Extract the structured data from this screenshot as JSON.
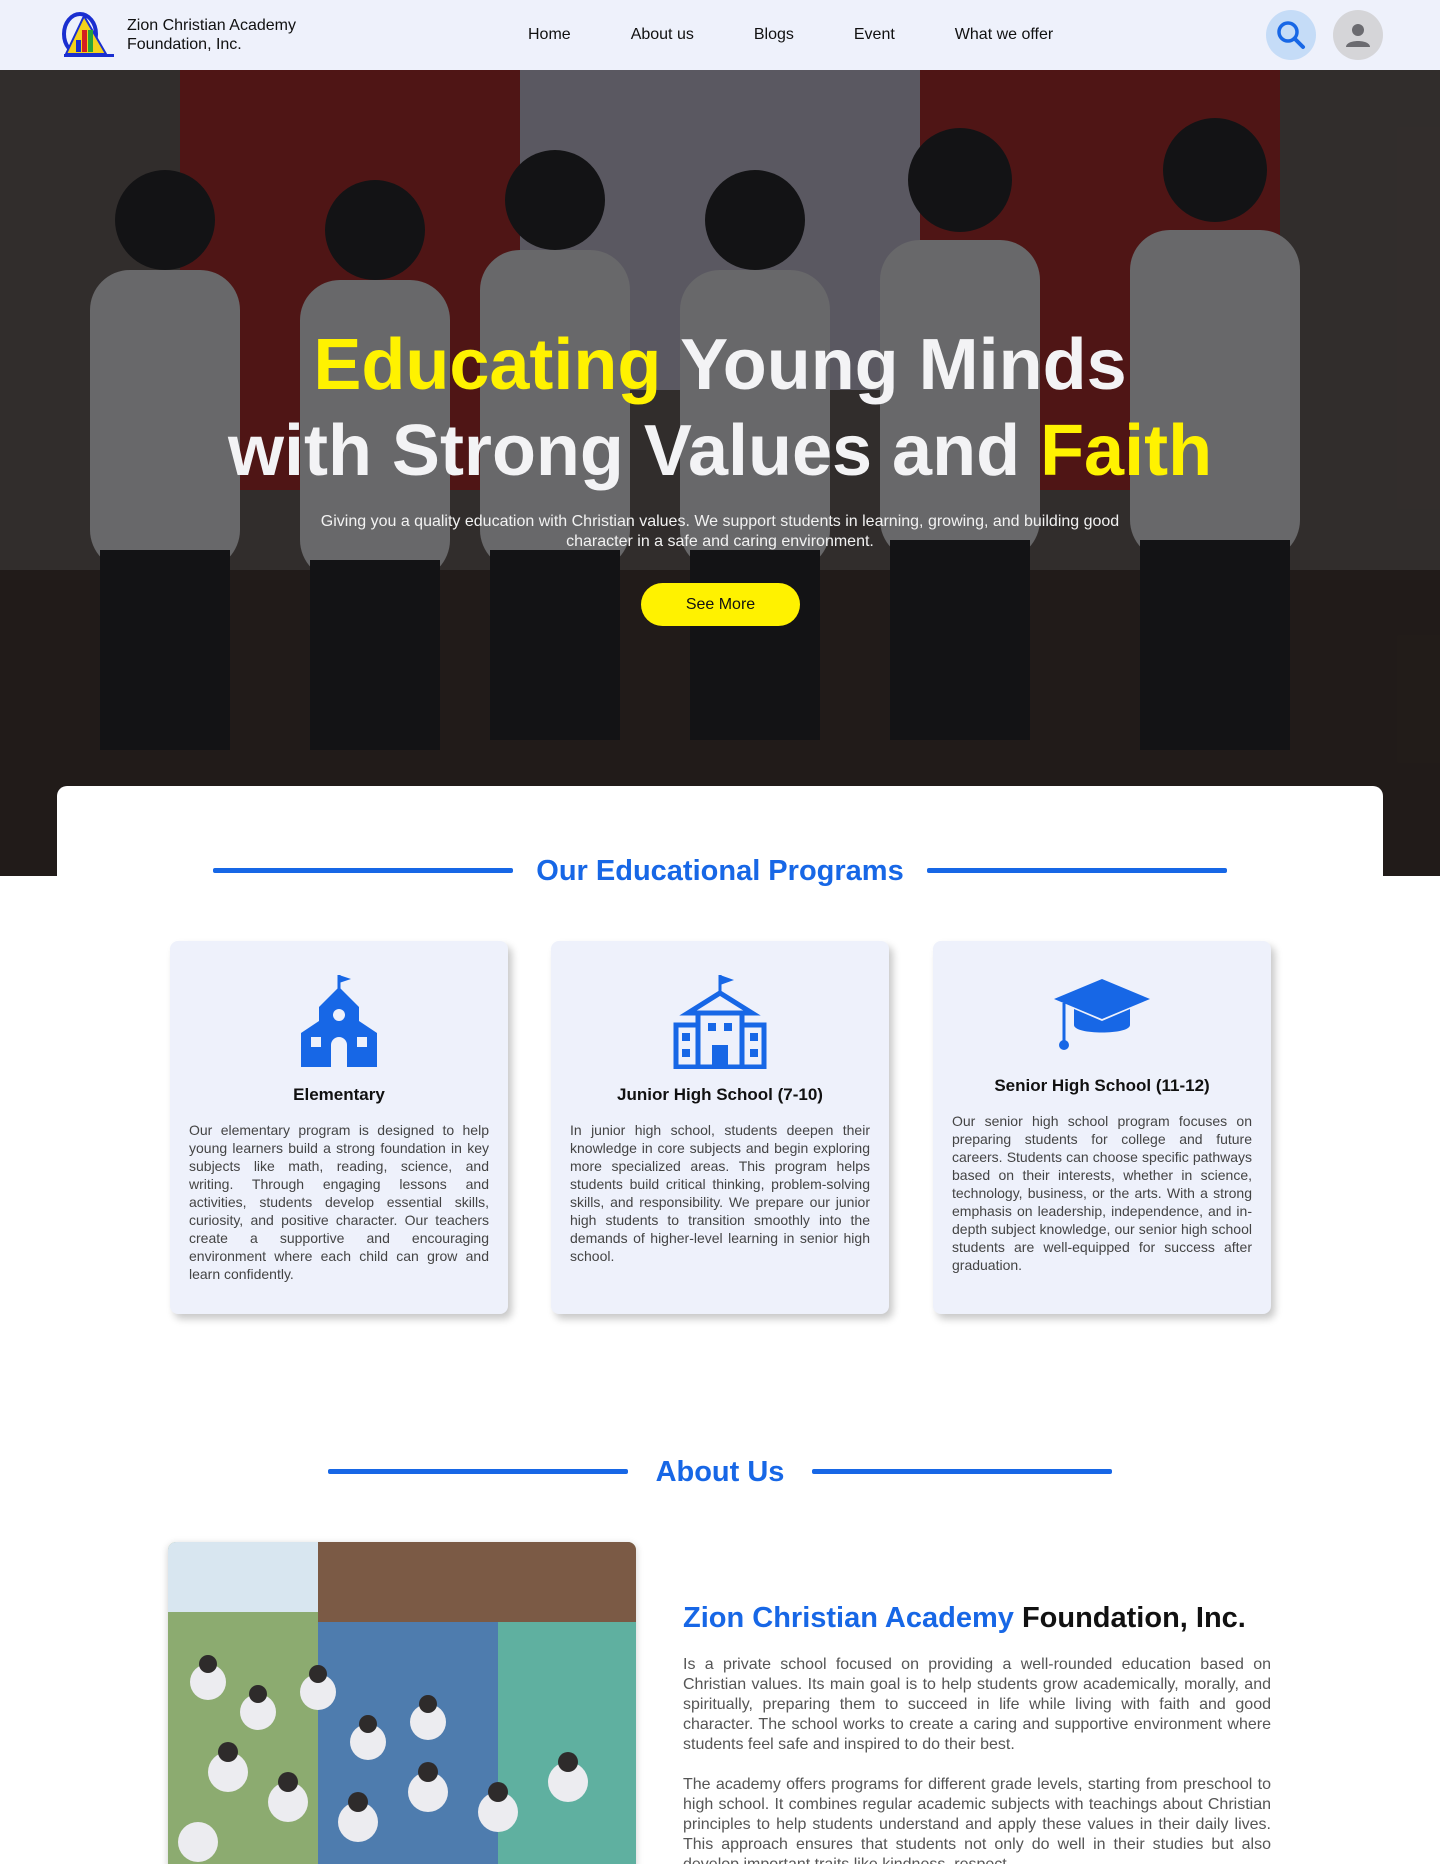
{
  "header": {
    "brand_line1": "Zion Christian Academy",
    "brand_line2": "Foundation, Inc.",
    "nav": [
      {
        "label": "Home"
      },
      {
        "label": "About us"
      },
      {
        "label": "Blogs"
      },
      {
        "label": "Event"
      },
      {
        "label": "What we offer"
      }
    ],
    "search_icon": "search-icon",
    "avatar_icon": "user-icon"
  },
  "hero": {
    "title_part1": "Educating",
    "title_part2": " Young Minds",
    "title_part3": "with Strong Values and ",
    "title_part4": "Faith",
    "subtitle": "Giving you a quality education with Christian values. We support students in learning, growing, and building good character in a safe and caring environment.",
    "button_label": "See More"
  },
  "programs": {
    "title": "Our Educational Programs",
    "cards": [
      {
        "icon": "school-icon",
        "title": "Elementary",
        "text": "Our elementary program is designed to help young learners build a strong foundation in key subjects like math, reading, science, and writing. Through engaging lessons and activities, students develop essential skills, curiosity, and positive character. Our teachers create a supportive and encouraging environment where each child can grow and learn confidently."
      },
      {
        "icon": "building-icon",
        "title": "Junior High School (7-10)",
        "text": "In junior high school, students deepen their knowledge in core subjects and begin exploring more specialized areas. This program helps students build critical thinking, problem-solving skills, and responsibility. We prepare our junior high students to transition smoothly into the demands of higher-level learning in senior high school."
      },
      {
        "icon": "graduation-cap-icon",
        "title": "Senior High School (11-12)",
        "text": "Our senior high school program focuses on preparing students for college and future careers. Students can choose specific pathways based on their interests, whether in science, technology, business, or the arts. With a strong emphasis on leadership, independence, and in-depth subject knowledge, our senior high school students are well-equipped for success after graduation."
      }
    ]
  },
  "about": {
    "title": "About Us",
    "heading_blue": "Zion Christian Academy",
    "heading_rest": " Foundation, Inc.",
    "p1": "Is a private school focused on providing a well-rounded education based on Christian values. Its main goal is to help students grow academically, morally, and spiritually, preparing them to succeed in life while living with faith and good character. The school works to create a caring and supportive environment where students feel safe and inspired to do their best.",
    "p2": "The academy offers programs for different grade levels, starting from preschool to high school. It combines regular academic subjects with teachings about Christian principles to help students understand and apply these values in their daily lives. This approach ensures that students not only do well in their studies but also develop important traits like kindness, respect,"
  },
  "colors": {
    "accent": "#1767e6",
    "highlight": "#fff200",
    "header_bg": "#eef1fb"
  }
}
